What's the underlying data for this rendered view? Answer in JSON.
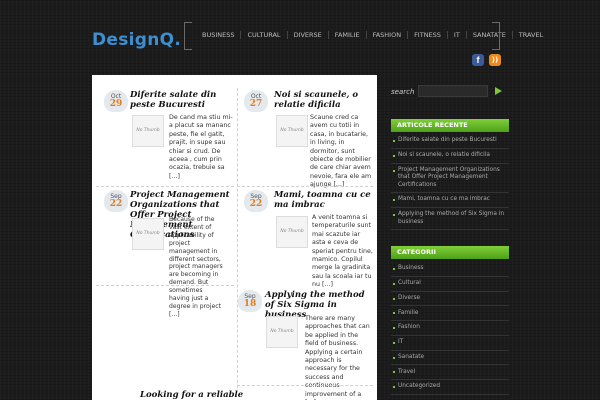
{
  "header": {
    "logo": "DesignQ.",
    "nav": [
      "BUSINESS",
      "CULTURAL",
      "DIVERSE",
      "FAMILIE",
      "FASHION",
      "FITNESS",
      "IT",
      "SANATATE",
      "TRAVEL"
    ],
    "social": {
      "facebook": "f",
      "rss": "))"
    }
  },
  "posts": [
    {
      "mon": "Oct",
      "day": "29",
      "title": "Diferite salate din peste Bucuresti",
      "thumb": "No Thumb",
      "excerpt": "De cand ma stiu mi-a placut sa mananc peste, fie el gatit, prajit, in supe sau chiar si crud. De aceea , cum prin ocazia, trebuie sa [...]"
    },
    {
      "mon": "Oct",
      "day": "27",
      "title": "Noi si scaunele, o relatie dificila",
      "thumb": "No Thumb",
      "excerpt": "Scaune cred ca avem cu totii in casa, in bucatarie, in living, in dormitor, sunt obiecte de mobilier de care chiar avem nevoie, fara ele am ajunge [...]"
    },
    {
      "mon": "Sep",
      "day": "22",
      "title": "Project Management Organizations that Offer Project Management Certifications",
      "thumb": "No Thumb",
      "excerpt": "Because of the vast extent of applicability of project management in different sectors, project managers are becoming in demand. But sometimes having just a degree in project [...]"
    },
    {
      "mon": "Sep",
      "day": "22",
      "title": "Mami, toamna cu ce ma imbrac",
      "thumb": "No Thumb",
      "excerpt": "A venit toamna si temperaturile sunt mai scazute iar asta e ceva de speriat pentru tine, mamico. Copilul merge la gradinita sau la scoala iar tu nu [...]"
    },
    {
      "mon": "Sep",
      "day": "18",
      "title": "Applying the method of Six Sigma in business",
      "thumb": "No Thumb",
      "excerpt": "There are many approaches that can be applied in the field of business. Applying a certain approach is necessary for the success and continuous improvement of a [...]"
    },
    {
      "title": "Looking for a reliable"
    }
  ],
  "sidebar": {
    "search_label": "search",
    "recent_title": "ARTICOLE RECENTE",
    "recent": [
      "Diferite salate din peste Bucuresti",
      "Noi si scaunele, o relatie dificila",
      "Project Management Organizations that Offer Project Management Certifications",
      "Mami, toamna cu ce ma imbrac",
      "Applying the method of Six Sigma in business"
    ],
    "categories_title": "CATEGORII",
    "categories": [
      "Business",
      "Cultural",
      "Diverse",
      "Familie",
      "Fashion",
      "IT",
      "Sanatate",
      "Travel",
      "Uncategorized"
    ]
  },
  "colors": {
    "accent": "#7ec63a",
    "logo": "#3d8fd1",
    "date_day": "#e57b1b"
  }
}
